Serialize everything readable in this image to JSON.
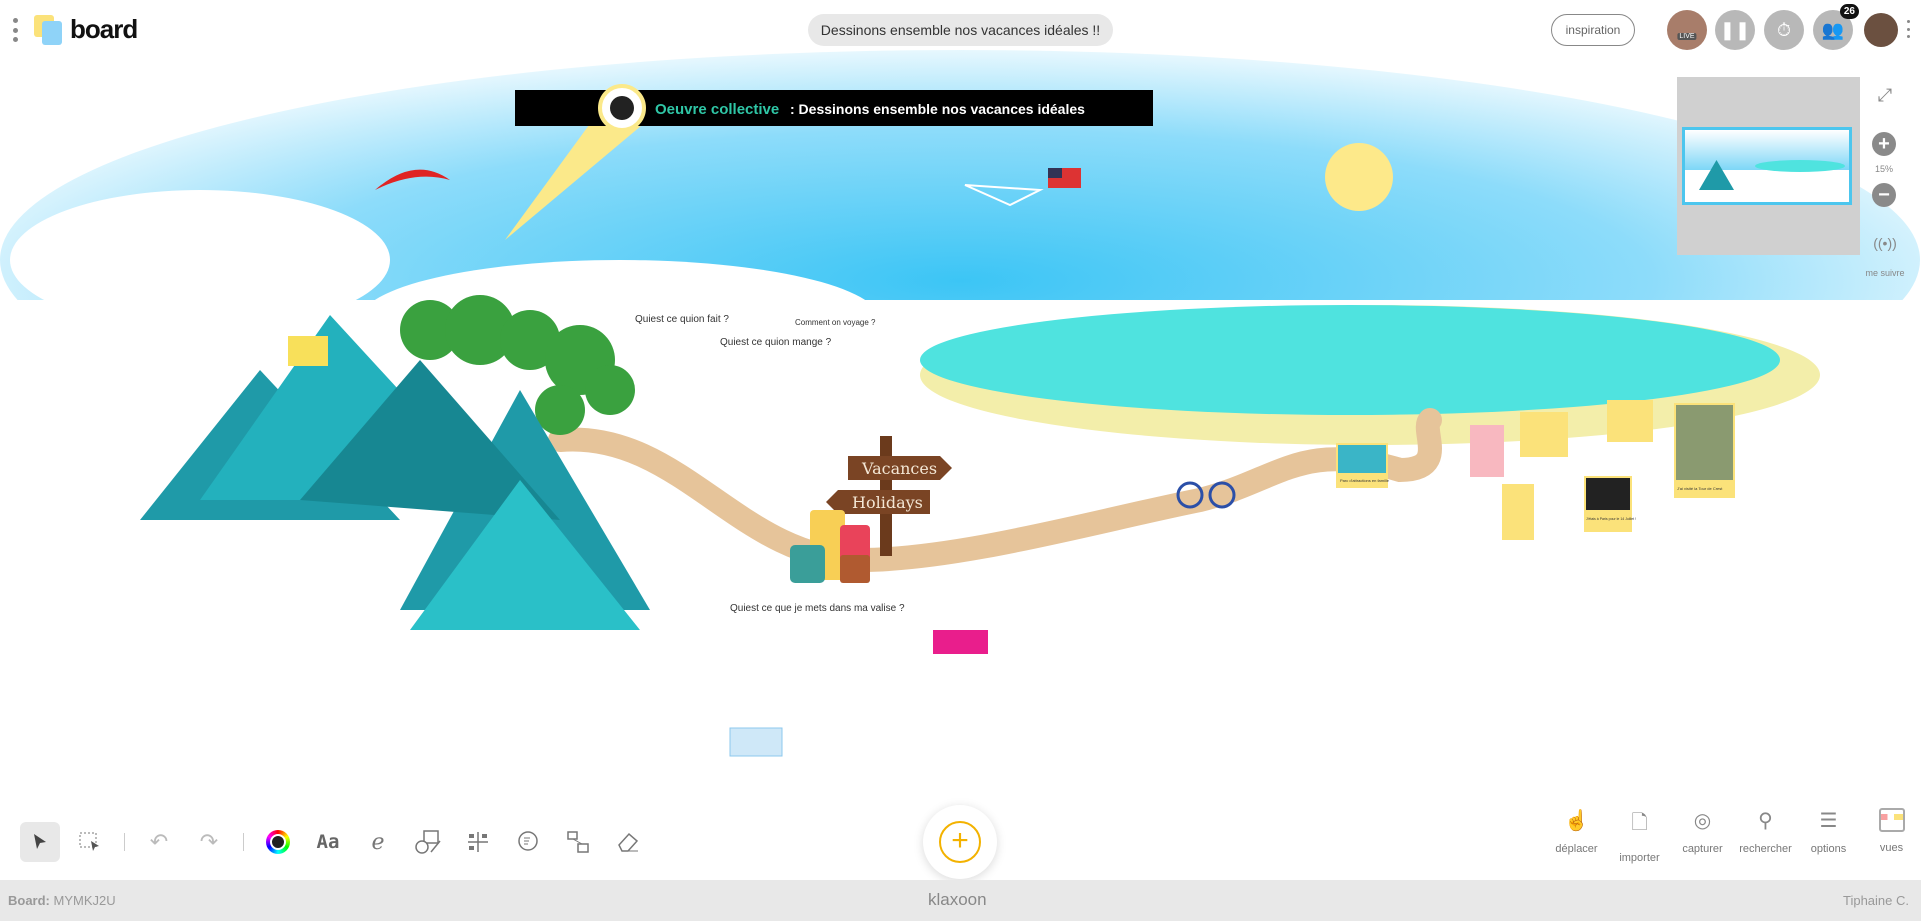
{
  "header": {
    "logo_text": "board",
    "title": "Dessinons ensemble nos vacances idéales !!",
    "inspiration_label": "inspiration",
    "live_label": "LIVE",
    "participants_count": "26"
  },
  "canvas": {
    "banner_highlight": "Oeuvre collective",
    "banner_text": ": Dessinons ensemble nos vacances idéales",
    "sign_top": "Vacances",
    "sign_bottom": "Holidays",
    "q_do": "Quiest ce quion fait ?",
    "q_eat": "Quiest ce quion mange ?",
    "q_travel": "Comment on voyage ?",
    "q_suitcase": "Quiest ce que je mets dans ma valise ?",
    "cards": [
      "Parc d'attractions en famille",
      "J'ai visité la Tour de Crest",
      "J'étais à Paris pour le 14 Juillet !"
    ]
  },
  "minimap": {
    "zoom_level": "15%",
    "follow_label": "me suivre"
  },
  "toolbar": {
    "tools": [
      "select",
      "multi-select",
      "undo",
      "redo",
      "color",
      "text",
      "draw",
      "shapes",
      "grid",
      "comment",
      "connector",
      "eraser"
    ],
    "text_glyph": "Aa",
    "add_glyph": "+"
  },
  "right_tools": [
    {
      "label": "déplacer"
    },
    {
      "label": "importer"
    },
    {
      "label": "capturer"
    },
    {
      "label": "rechercher"
    },
    {
      "label": "options"
    },
    {
      "label": "vues"
    }
  ],
  "footer": {
    "board_label": "Board:",
    "board_code": "MYMKJ2U",
    "brand": "klaxoon",
    "user": "Tiphaine C."
  },
  "colors": {
    "sky": "#3cc5f5",
    "sea": "#4fe3df",
    "sand": "#f3eeaa",
    "path": "#e6c49a",
    "mountain": "#1f9aa8",
    "accent": "#f3b200",
    "banner_accent": "#2fc6a6"
  }
}
